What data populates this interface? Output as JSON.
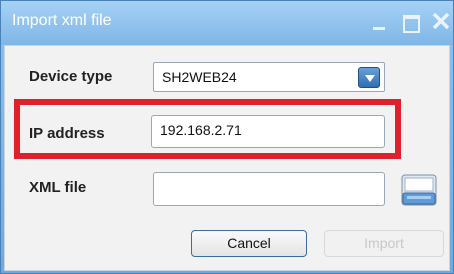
{
  "window": {
    "title": "Import xml file"
  },
  "form": {
    "device_type": {
      "label": "Device type",
      "value": "SH2WEB24"
    },
    "ip_address": {
      "label": "IP address",
      "value": "192.168.2.71"
    },
    "xml_file": {
      "label": "XML file",
      "value": ""
    }
  },
  "buttons": {
    "cancel": "Cancel",
    "import": "Import"
  },
  "icons": {
    "minimize": "minimize-icon",
    "maximize": "maximize-icon",
    "close": "close-icon",
    "dropdown": "chevron-down-icon",
    "browse": "folder-browse-icon"
  },
  "colors": {
    "titlebar": "#8fc3f0",
    "highlight_border": "#e0202a",
    "button_border": "#3a6da6"
  }
}
